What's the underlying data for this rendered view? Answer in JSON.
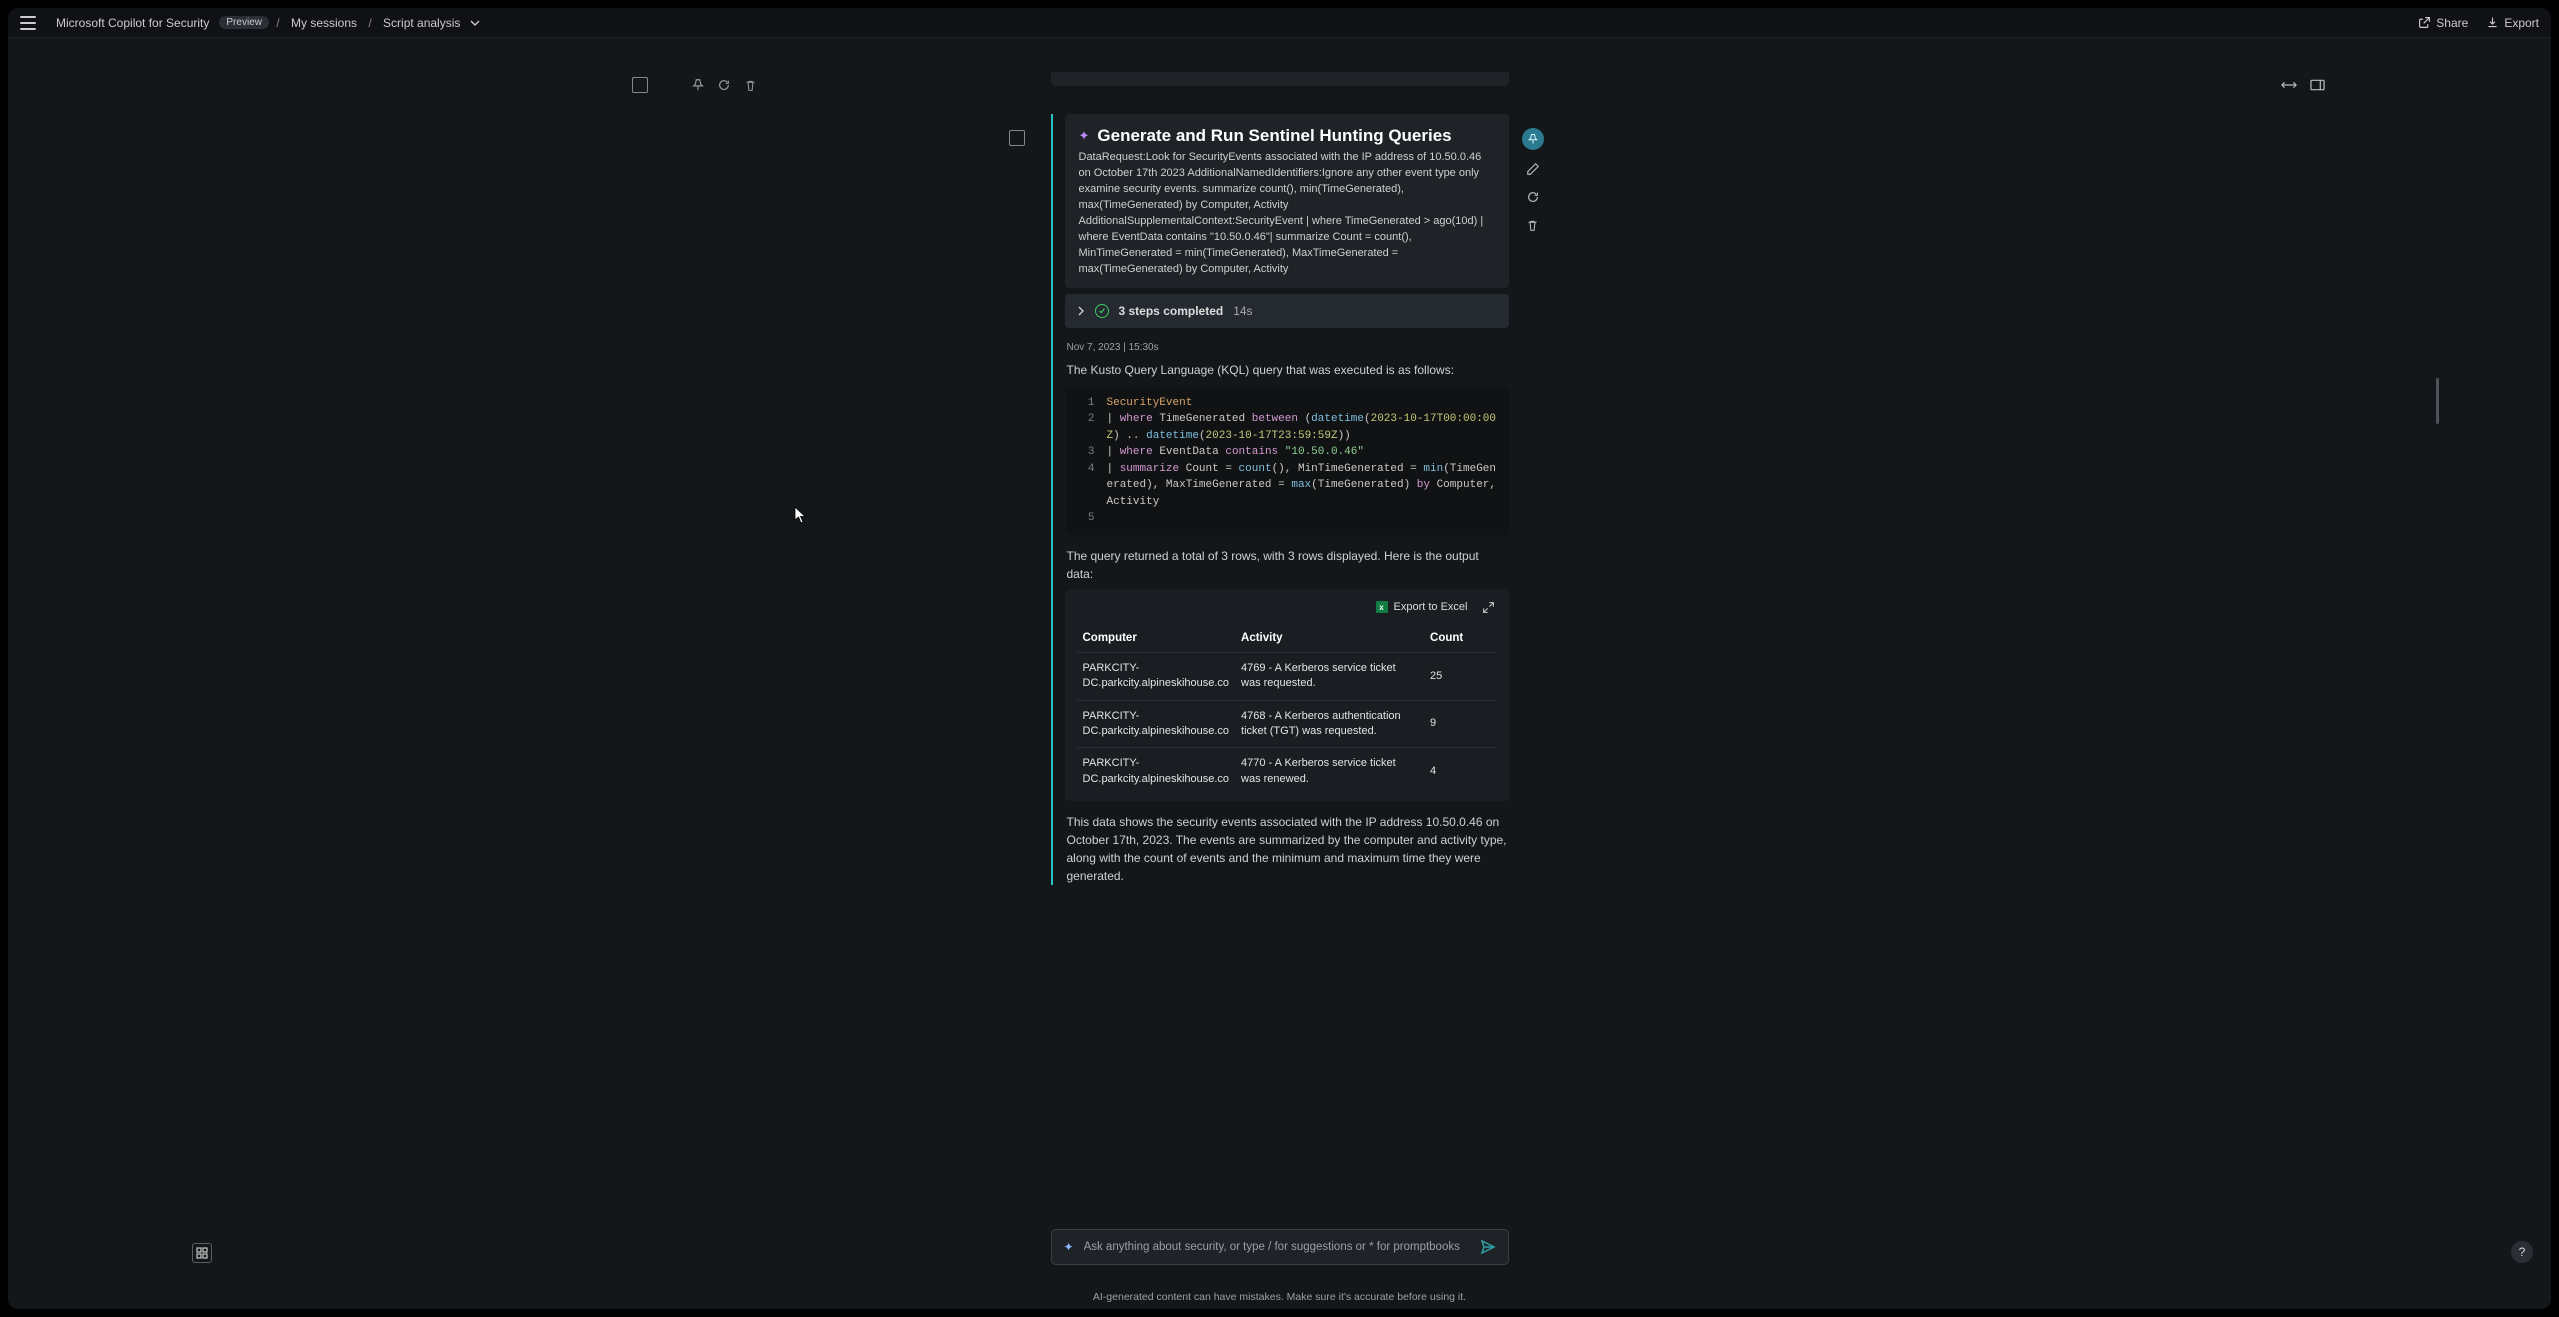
{
  "header": {
    "product": "Microsoft Copilot for Security",
    "badge": "Preview",
    "crumb1": "My sessions",
    "crumb2": "Script analysis",
    "share": "Share",
    "export": "Export"
  },
  "card": {
    "title": "Generate and Run Sentinel Hunting Queries",
    "desc": "DataRequest:Look for SecurityEvents associated with the IP address of 10.50.0.46 on October 17th 2023 AdditionalNamedIdentifiers:Ignore any other event type only examine security events. summarize count(), min(TimeGenerated), max(TimeGenerated) by Computer, Activity AdditionalSupplementalContext:SecurityEvent | where TimeGenerated > ago(10d) | where EventData contains \"10.50.0.46\"| summarize Count = count(), MinTimeGenerated = min(TimeGenerated), MaxTimeGenerated = max(TimeGenerated) by Computer, Activity",
    "steps_label": "3 steps completed",
    "steps_time": "14s",
    "timestamp": "Nov 7, 2023  |  15:30s",
    "intro": "The Kusto Query Language (KQL) query that was executed is as follows:",
    "result_intro": "The query returned a total of 3 rows, with 3 rows displayed. Here is the output data:",
    "summary": "This data shows the security events associated with the IP address 10.50.0.46 on October 17th, 2023. The events are summarized by the computer and activity type, along with the count of events and the minimum and maximum time they were generated."
  },
  "code": {
    "l1": "SecurityEvent",
    "l2a": "| ",
    "l2b": "where",
    "l2c": " TimeGenerated ",
    "l2d": "between",
    "l2e": " (",
    "l2f": "datetime",
    "l2g": "(",
    "l2h": "2023-10-17T00:00:00Z",
    "l2i": ") .. ",
    "l2j": "datetime",
    "l2k": "(",
    "l2l": "2023-10-17T23:59:59Z",
    "l2m": "))",
    "l3a": "| ",
    "l3b": "where",
    "l3c": " EventData ",
    "l3d": "contains",
    "l3e": " ",
    "l3f": "\"10.50.0.46\"",
    "l4a": "| ",
    "l4b": "summarize",
    "l4c": " Count = ",
    "l4d": "count",
    "l4e": "(), MinTimeGenerated = ",
    "l4f": "min",
    "l4g": "(TimeGenerated), MaxTimeGenerated = ",
    "l4h": "max",
    "l4i": "(TimeGenerated) ",
    "l4j": "by",
    "l4k": " Computer, Activity"
  },
  "table": {
    "export_label": "Export to Excel",
    "h1": "Computer",
    "h2": "Activity",
    "h3": "Count",
    "rows": [
      {
        "computer": "PARKCITY-DC.parkcity.alpineskihouse.co",
        "activity": "4769 - A Kerberos service ticket was requested.",
        "count": "25"
      },
      {
        "computer": "PARKCITY-DC.parkcity.alpineskihouse.co",
        "activity": "4768 - A Kerberos authentication ticket (TGT) was requested.",
        "count": "9"
      },
      {
        "computer": "PARKCITY-DC.parkcity.alpineskihouse.co",
        "activity": "4770 - A Kerberos service ticket was renewed.",
        "count": "4"
      }
    ]
  },
  "prompt": {
    "placeholder": "Ask anything about security, or type / for suggestions or * for promptbooks"
  },
  "footer": {
    "disclaimer": "AI-generated content can have mistakes. Make sure it's accurate before using it."
  },
  "help": "?"
}
